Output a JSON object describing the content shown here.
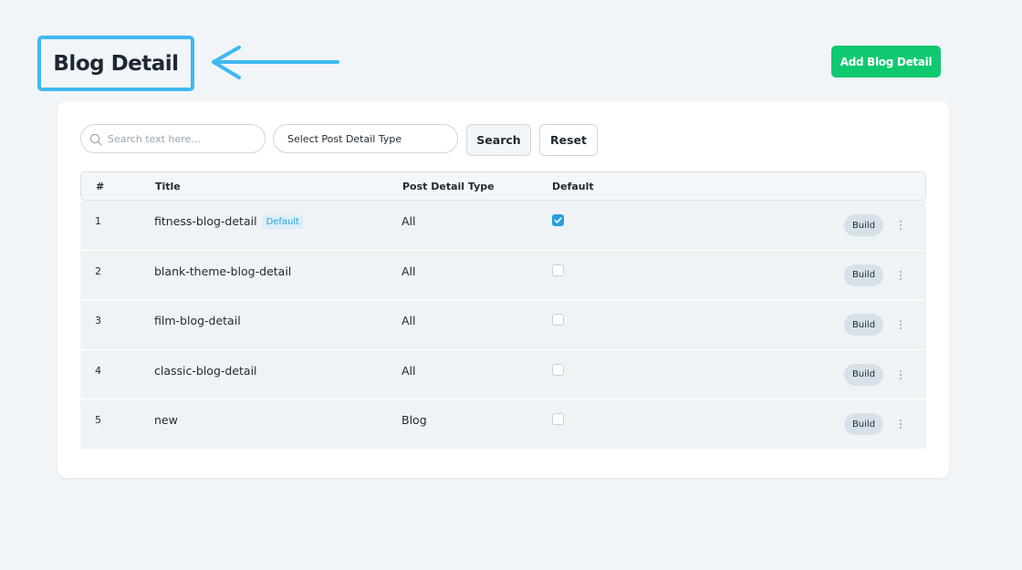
{
  "header": {
    "title": "Blog Detail",
    "add_button": "Add Blog Detail",
    "accent_color": "#0fc970",
    "highlight_color": "#3fb8f0"
  },
  "filters": {
    "search_placeholder": "Search text here...",
    "search_value": "",
    "select_label": "Select Post Detail Type",
    "search_button": "Search",
    "reset_button": "Reset"
  },
  "table": {
    "columns": [
      "#",
      "Title",
      "Post Detail Type",
      "Default"
    ],
    "rows": [
      {
        "num": "1",
        "title": "fitness-blog-detail",
        "badge": "Default",
        "type": "All",
        "default": true,
        "action": "Build"
      },
      {
        "num": "2",
        "title": "blank-theme-blog-detail",
        "badge": "",
        "type": "All",
        "default": false,
        "action": "Build"
      },
      {
        "num": "3",
        "title": "film-blog-detail",
        "badge": "",
        "type": "All",
        "default": false,
        "action": "Build"
      },
      {
        "num": "4",
        "title": "classic-blog-detail",
        "badge": "",
        "type": "All",
        "default": false,
        "action": "Build"
      },
      {
        "num": "5",
        "title": "new",
        "badge": "",
        "type": "Blog",
        "default": false,
        "action": "Build"
      }
    ]
  },
  "icons": {
    "search": "search-icon",
    "arrow": "arrow-left-icon",
    "more": "more-vertical-icon",
    "check": "check-icon"
  }
}
